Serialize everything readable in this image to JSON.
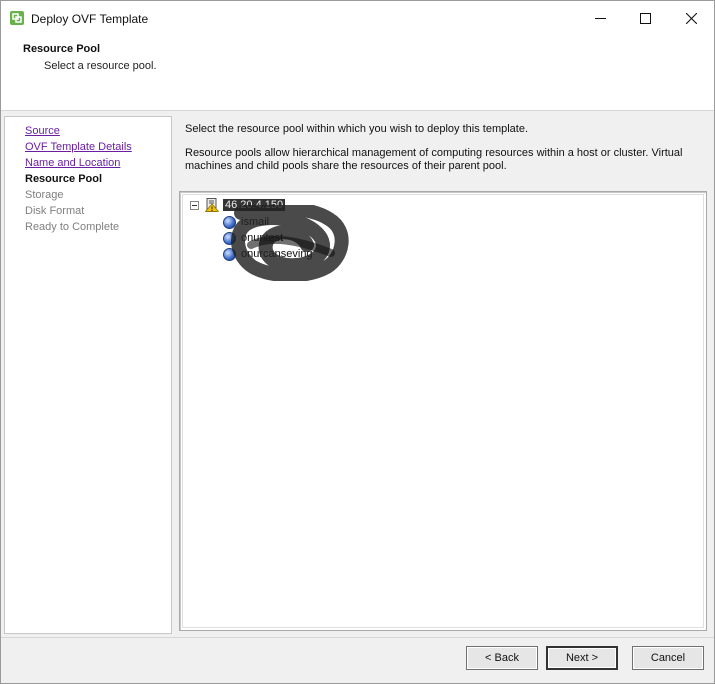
{
  "window": {
    "title": "Deploy OVF Template"
  },
  "header": {
    "title": "Resource Pool",
    "subtitle": "Select a resource pool."
  },
  "steps": [
    {
      "label": "Source",
      "state": "done"
    },
    {
      "label": "OVF Template Details",
      "state": "done"
    },
    {
      "label": "Name and Location",
      "state": "done"
    },
    {
      "label": "Resource Pool",
      "state": "current"
    },
    {
      "label": "Storage",
      "state": "pending"
    },
    {
      "label": "Disk Format",
      "state": "pending"
    },
    {
      "label": "Ready to Complete",
      "state": "pending"
    }
  ],
  "main": {
    "instruction": "Select the resource pool within which you wish to deploy this template.",
    "description": "Resource pools allow hierarchical management of computing resources within a host or cluster. Virtual machines and child pools share the resources of their parent pool."
  },
  "tree": {
    "host": {
      "label": "46.20.4.150",
      "icon": "warning-host-icon"
    },
    "pools": [
      {
        "label": "ismail",
        "icon": "resource-pool-icon"
      },
      {
        "label": "onuntest",
        "icon": "resource-pool-icon"
      },
      {
        "label": "onurcanseving",
        "icon": "resource-pool-icon"
      }
    ]
  },
  "footer": {
    "back_label": "< Back",
    "next_label": "Next >",
    "cancel_label": "Cancel"
  },
  "colors": {
    "link": "#6a1fa0",
    "pending": "#808080",
    "panel_bg": "#f0f0f0"
  }
}
